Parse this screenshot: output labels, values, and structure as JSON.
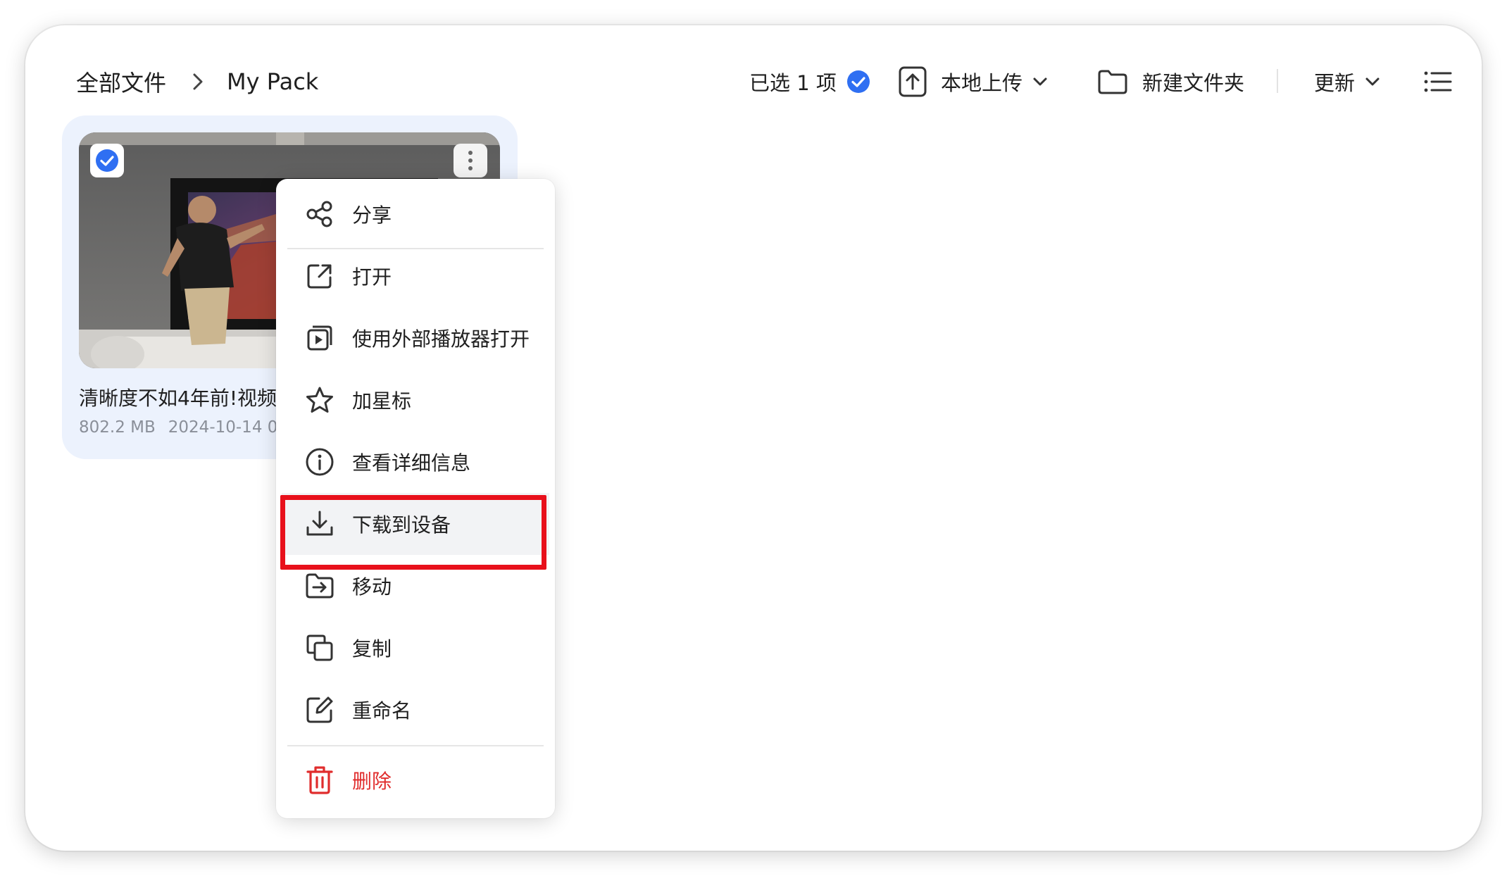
{
  "breadcrumb": {
    "root": "全部文件",
    "current": "My Pack"
  },
  "toolbar": {
    "selected_label": "已选 1 项",
    "upload_label": "本地上传",
    "new_folder_label": "新建文件夹",
    "sort_label": "更新"
  },
  "file": {
    "name": "清晰度不如4年前!视频",
    "size": "802.2 MB",
    "date": "2024-10-14 0"
  },
  "menu": {
    "items": [
      {
        "label": "分享",
        "icon": "share-icon"
      },
      {
        "label": "打开",
        "icon": "open-external-icon"
      },
      {
        "label": "使用外部播放器打开",
        "icon": "external-player-icon"
      },
      {
        "label": "加星标",
        "icon": "star-icon"
      },
      {
        "label": "查看详细信息",
        "icon": "info-icon"
      },
      {
        "label": "下载到设备",
        "icon": "download-icon"
      },
      {
        "label": "移动",
        "icon": "move-icon"
      },
      {
        "label": "复制",
        "icon": "copy-icon"
      },
      {
        "label": "重命名",
        "icon": "rename-icon"
      },
      {
        "label": "删除",
        "icon": "trash-icon"
      }
    ]
  },
  "colors": {
    "accent": "#2f6ff2",
    "danger": "#e02d2d",
    "highlight_border": "#e8101b",
    "card_bg": "#ecf2fd"
  }
}
